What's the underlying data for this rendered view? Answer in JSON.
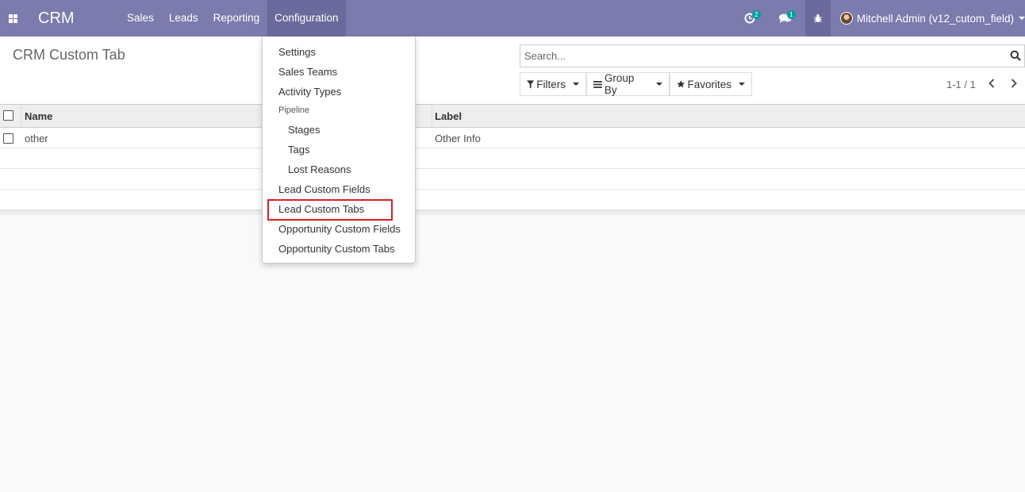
{
  "navbar": {
    "brand": "CRM",
    "menu": [
      "Sales",
      "Leads",
      "Reporting",
      "Configuration"
    ],
    "activity_count": "2",
    "messages_count": "1",
    "user_name": "Mitchell Admin (v12_cutom_field)",
    "bg_color": "#7c7bad"
  },
  "control_panel": {
    "title": "CRM Custom Tab",
    "search_placeholder": "Search...",
    "filters_label": "Filters",
    "group_by_label": "Group By",
    "favorites_label": "Favorites",
    "pager": "1-1 / 1"
  },
  "list": {
    "columns": [
      "Name",
      "Label"
    ],
    "rows": [
      {
        "name": "other",
        "label": "Other Info"
      }
    ]
  },
  "dropdown": {
    "settings": "Settings",
    "sales_teams": "Sales Teams",
    "activity_types": "Activity Types",
    "pipeline_header": "Pipeline",
    "stages": "Stages",
    "tags": "Tags",
    "lost_reasons": "Lost Reasons",
    "lead_custom_fields": "Lead Custom Fields",
    "lead_custom_tabs": "Lead Custom Tabs",
    "opportunity_custom_fields": "Opportunity Custom Fields",
    "opportunity_custom_tabs": "Opportunity Custom Tabs",
    "highlight_color": "#dd1f26"
  }
}
